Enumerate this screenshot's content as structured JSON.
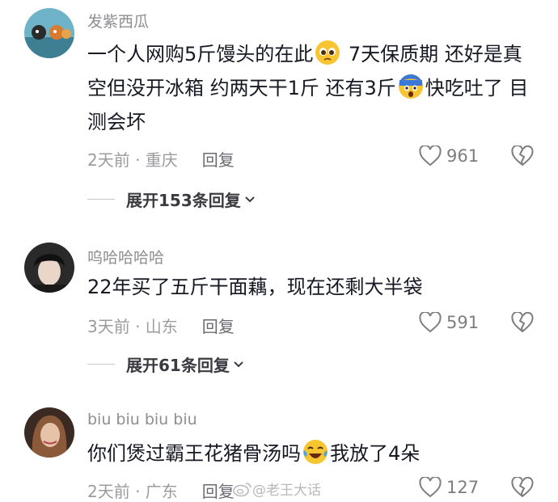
{
  "comments": [
    {
      "username": "发紫西瓜",
      "text_part1": "一个人网购5斤馒头的在此",
      "text_part2": " 7天保质期 还好是真空但没开冰箱 约两天干1斤 还有3斤",
      "text_part3": "快吃吐了 目测会坏",
      "time_location": "2天前 · 重庆",
      "reply_label": "回复",
      "likes": "961",
      "expand_label": "展开153条回复"
    },
    {
      "username": "呜哈哈哈哈",
      "text": "22年买了五斤干面藕，现在还剩大半袋",
      "time_location": "3天前 · 山东",
      "reply_label": "回复",
      "likes": "591",
      "expand_label": "展开61条回复"
    },
    {
      "username": "biu biu biu biu",
      "text_part1": "你们煲过霸王花猪骨汤吗",
      "text_part2": "我放了4朵",
      "time_location": "2天前 · 广东",
      "reply_label": "回复",
      "likes": "127"
    }
  ],
  "watermark": "@老王大话",
  "icons": {
    "like": "heart-outline-icon",
    "dislike": "broken-heart-icon",
    "expand": "chevron-down-icon",
    "watermark": "weibo-logo-icon"
  }
}
